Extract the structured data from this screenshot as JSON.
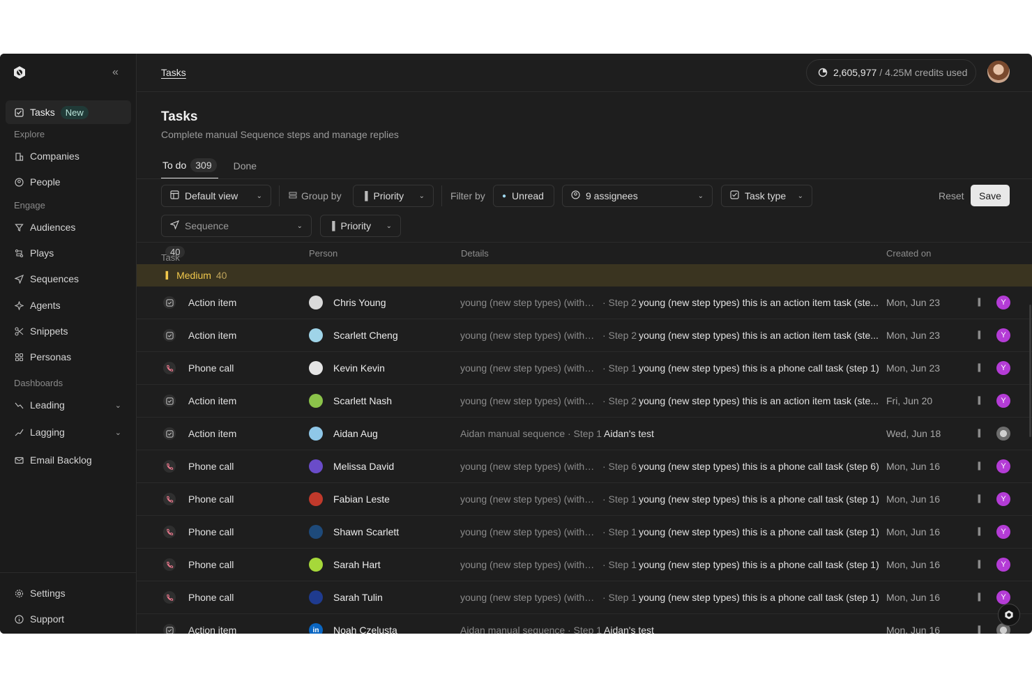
{
  "sidebar": {
    "collapse_label": "«",
    "tasks": {
      "label": "Tasks",
      "badge": "New",
      "icon": "checkbox-icon"
    },
    "sections": {
      "explore": "Explore",
      "engage": "Engage",
      "dashboards": "Dashboards"
    },
    "items": [
      {
        "label": "Companies",
        "icon": "building-icon"
      },
      {
        "label": "People",
        "icon": "person-circle-icon"
      },
      {
        "label": "Audiences",
        "icon": "filter-icon"
      },
      {
        "label": "Plays",
        "icon": "plays-icon"
      },
      {
        "label": "Sequences",
        "icon": "send-icon"
      },
      {
        "label": "Agents",
        "icon": "sparkle-icon"
      },
      {
        "label": "Snippets",
        "icon": "scissors-icon"
      },
      {
        "label": "Personas",
        "icon": "grid-icon"
      },
      {
        "label": "Leading",
        "icon": "trend-icon"
      },
      {
        "label": "Lagging",
        "icon": "trend-icon"
      },
      {
        "label": "Email Backlog",
        "icon": "mail-icon"
      }
    ],
    "bottom": [
      {
        "label": "Settings",
        "icon": "gear-icon"
      },
      {
        "label": "Support",
        "icon": "info-icon"
      }
    ]
  },
  "topbar": {
    "breadcrumb": "Tasks",
    "credits_used_value": "2,605,977",
    "credits_total": "/ 4.25M credits used"
  },
  "page": {
    "title": "Tasks",
    "subtitle": "Complete manual Sequence steps and manage replies",
    "tabs": [
      {
        "label": "To do",
        "count": "309"
      },
      {
        "label": "Done"
      }
    ]
  },
  "filters": {
    "view": "Default view",
    "group_by_label": "Group by",
    "group_by_value": "Priority",
    "filter_by_label": "Filter by",
    "unread": "Unread",
    "assignees": "9 assignees",
    "task_type": "Task type",
    "reset": "Reset",
    "save": "Save",
    "sequence_placeholder": "Sequence",
    "priority": "Priority"
  },
  "table": {
    "columns": {
      "task": "Task",
      "task_count": "40",
      "person": "Person",
      "details": "Details",
      "created": "Created on"
    },
    "group": {
      "label": "Medium",
      "count": "40"
    },
    "rows": [
      {
        "type": "Action item",
        "kind": "action",
        "person": "Chris Young",
        "avatar": "#d9d9d9",
        "seq": "young (new step types) (withou...",
        "step": "· Step 2",
        "desc": "young (new step types) this is an action item task (ste...",
        "date": "Mon, Jun 23",
        "assignee": "Y"
      },
      {
        "type": "Action item",
        "kind": "action",
        "person": "Scarlett Cheng",
        "avatar": "#9fd4e8",
        "seq": "young (new step types) (withou...",
        "step": "· Step 2",
        "desc": "young (new step types) this is an action item task (ste...",
        "date": "Mon, Jun 23",
        "assignee": "Y"
      },
      {
        "type": "Phone call",
        "kind": "call",
        "person": "Kevin Kevin",
        "avatar": "#e5e5e5",
        "seq": "young (new step types) (withou...",
        "step": "· Step 1",
        "desc": "young (new step types) this is a phone call task (step 1)",
        "date": "Mon, Jun 23",
        "assignee": "Y"
      },
      {
        "type": "Action item",
        "kind": "action",
        "person": "Scarlett Nash",
        "avatar": "#8bc34a",
        "seq": "young (new step types) (withou...",
        "step": "· Step 2",
        "desc": "young (new step types) this is an action item task (ste...",
        "date": "Fri, Jun 20",
        "assignee": "Y"
      },
      {
        "type": "Action item",
        "kind": "action",
        "person": "Aidan Aug",
        "avatar": "#8fc7e8",
        "seq": "Aidan manual sequence",
        "step": "· Step 1",
        "desc": "Aidan's test",
        "date": "Wed, Jun 18",
        "assignee": ""
      },
      {
        "type": "Phone call",
        "kind": "call",
        "person": "Melissa David",
        "avatar": "#6a4cc9",
        "seq": "young (new step types) (withou...",
        "step": "· Step 6",
        "desc": "young (new step types) this is a phone call task (step 6)",
        "date": "Mon, Jun 16",
        "assignee": "Y"
      },
      {
        "type": "Phone call",
        "kind": "call",
        "person": "Fabian Leste",
        "avatar": "#c0392b",
        "seq": "young (new step types) (withou...",
        "step": "· Step 1",
        "desc": "young (new step types) this is a phone call task (step 1)",
        "date": "Mon, Jun 16",
        "assignee": "Y"
      },
      {
        "type": "Phone call",
        "kind": "call",
        "person": "Shawn Scarlett",
        "avatar": "#1e4a7a",
        "seq": "young (new step types) (withou...",
        "step": "· Step 1",
        "desc": "young (new step types) this is a phone call task (step 1)",
        "date": "Mon, Jun 16",
        "assignee": "Y"
      },
      {
        "type": "Phone call",
        "kind": "call",
        "person": "Sarah Hart",
        "avatar": "#a6d83a",
        "seq": "young (new step types) (withou...",
        "step": "· Step 1",
        "desc": "young (new step types) this is a phone call task (step 1)",
        "date": "Mon, Jun 16",
        "assignee": "Y"
      },
      {
        "type": "Phone call",
        "kind": "call",
        "person": "Sarah Tulin",
        "avatar": "#1f3b8f",
        "seq": "young (new step types) (withou...",
        "step": "· Step 1",
        "desc": "young (new step types) this is a phone call task (step 1)",
        "date": "Mon, Jun 16",
        "assignee": "Y"
      },
      {
        "type": "Action item",
        "kind": "action",
        "person": "Noah Czelusta",
        "avatar": "#0a66c2",
        "avatar_text": "in",
        "seq": "Aidan manual sequence",
        "step": "· Step 1",
        "desc": "Aidan's test",
        "date": "Mon, Jun 16",
        "assignee": ""
      }
    ]
  }
}
